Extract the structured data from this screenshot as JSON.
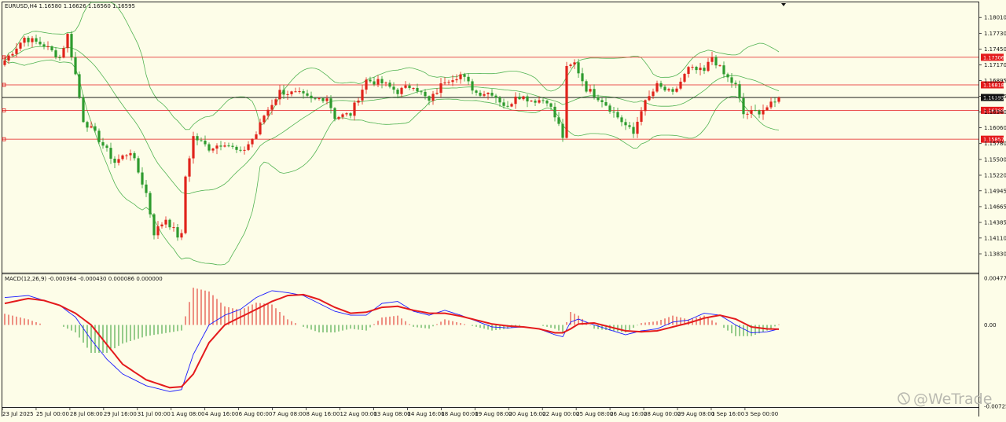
{
  "window": {
    "symbol_info": "EURUSD,H4  1.16580 1.16626 1.16560 1.16595",
    "macd_info": "MACD(12,26,9) -0.000364 -0.000430 0.000086 0.000000",
    "watermark": "@WeTrade"
  },
  "colors": {
    "background": "#fdfde8",
    "bull": "#e0231b",
    "bear": "#2e9b2e",
    "band": "#52b352",
    "hline": "#e41a1c",
    "price_line": "#000000",
    "macd_line": "#1a1aff",
    "signal_line": "#e41a1c"
  },
  "chart_data": [
    {
      "type": "candlestick",
      "title": "EURUSD,H4",
      "y_ticks": [
        "1.18010",
        "1.17730",
        "1.17450",
        "1.17170",
        "1.16895",
        "1.16615",
        "1.16340",
        "1.16060",
        "1.15780",
        "1.15500",
        "1.15220",
        "1.14945",
        "1.14665",
        "1.14385",
        "1.14110",
        "1.13830"
      ],
      "ylim": [
        1.1383,
        1.1818
      ],
      "x_ticks": [
        "23 Jul 2025",
        "25 Jul 00:00",
        "28 Jul 08:00",
        "29 Jul 16:00",
        "31 Jul 00:00",
        "1 Aug 08:00",
        "4 Aug 16:00",
        "6 Aug 00:00",
        "7 Aug 08:00",
        "8 Aug 16:00",
        "12 Aug 00:00",
        "13 Aug 08:00",
        "14 Aug 16:00",
        "18 Aug 00:00",
        "19 Aug 08:00",
        "20 Aug 16:00",
        "22 Aug 00:00",
        "25 Aug 08:00",
        "26 Aug 16:00",
        "28 Aug 00:00",
        "29 Aug 08:00",
        "1 Sep 16:00",
        "3 Sep 00:00"
      ],
      "horizontal_levels": [
        {
          "value": 1.17306,
          "label": "1.17306"
        },
        {
          "value": 1.16818,
          "label": "1.16818"
        },
        {
          "value": 1.16368,
          "label": "1.16368"
        },
        {
          "value": 1.15857,
          "label": "1.15857"
        }
      ],
      "current_price": {
        "value": 1.16595,
        "label": "1.16595"
      },
      "indicators": [
        "Bollinger Bands"
      ],
      "candles_close_anchors": [
        [
          0,
          1.1725
        ],
        [
          5,
          1.1765
        ],
        [
          10,
          1.1752
        ],
        [
          14,
          1.173
        ],
        [
          16,
          1.177
        ],
        [
          18,
          1.17
        ],
        [
          20,
          1.162
        ],
        [
          23,
          1.1595
        ],
        [
          28,
          1.1545
        ],
        [
          32,
          1.1565
        ],
        [
          36,
          1.149
        ],
        [
          38,
          1.142
        ],
        [
          41,
          1.1445
        ],
        [
          44,
          1.1415
        ],
        [
          45,
          1.1415
        ],
        [
          46,
          1.152
        ],
        [
          48,
          1.159
        ],
        [
          52,
          1.157
        ],
        [
          56,
          1.158
        ],
        [
          60,
          1.156
        ],
        [
          64,
          1.1595
        ],
        [
          66,
          1.1628
        ],
        [
          70,
          1.167
        ],
        [
          75,
          1.1665
        ],
        [
          78,
          1.1655
        ],
        [
          82,
          1.166
        ],
        [
          84,
          1.1625
        ],
        [
          88,
          1.163
        ],
        [
          92,
          1.169
        ],
        [
          96,
          1.1685
        ],
        [
          100,
          1.167
        ],
        [
          104,
          1.1682
        ],
        [
          108,
          1.1652
        ],
        [
          112,
          1.169
        ],
        [
          116,
          1.17
        ],
        [
          120,
          1.1668
        ],
        [
          124,
          1.1668
        ],
        [
          128,
          1.164
        ],
        [
          130,
          1.1665
        ],
        [
          134,
          1.1655
        ],
        [
          138,
          1.1655
        ],
        [
          141,
          1.161
        ],
        [
          142,
          1.159
        ],
        [
          143,
          1.171
        ],
        [
          145,
          1.172
        ],
        [
          148,
          1.1675
        ],
        [
          152,
          1.1655
        ],
        [
          156,
          1.1625
        ],
        [
          160,
          1.1595
        ],
        [
          162,
          1.164
        ],
        [
          166,
          1.168
        ],
        [
          170,
          1.1665
        ],
        [
          174,
          1.171
        ],
        [
          178,
          1.1705
        ],
        [
          180,
          1.1732
        ],
        [
          183,
          1.17
        ],
        [
          186,
          1.168
        ],
        [
          188,
          1.163
        ],
        [
          192,
          1.1635
        ],
        [
          196,
          1.165
        ],
        [
          197,
          1.16595
        ]
      ]
    },
    {
      "type": "macd",
      "title": "MACD(12,26,9)",
      "y_ticks": [
        "0.004774",
        "0.00",
        "-0.007257"
      ],
      "ylim": [
        -0.007257,
        0.004774
      ],
      "values": {
        "main": -0.000364,
        "signal": -0.00043,
        "histogram": 8.6e-05
      },
      "macd_anchors": [
        [
          0,
          0.0028
        ],
        [
          6,
          0.003
        ],
        [
          10,
          0.0025
        ],
        [
          14,
          0.002
        ],
        [
          18,
          0.0008
        ],
        [
          22,
          -0.0015
        ],
        [
          26,
          -0.0035
        ],
        [
          30,
          -0.005
        ],
        [
          36,
          -0.0062
        ],
        [
          42,
          -0.0068
        ],
        [
          45,
          -0.0066
        ],
        [
          48,
          -0.003
        ],
        [
          52,
          0.0
        ],
        [
          56,
          0.001
        ],
        [
          60,
          0.0016
        ],
        [
          64,
          0.0028
        ],
        [
          68,
          0.0035
        ],
        [
          72,
          0.0033
        ],
        [
          76,
          0.003
        ],
        [
          80,
          0.0022
        ],
        [
          84,
          0.0014
        ],
        [
          88,
          0.001
        ],
        [
          92,
          0.001
        ],
        [
          96,
          0.0022
        ],
        [
          100,
          0.0024
        ],
        [
          104,
          0.0014
        ],
        [
          108,
          0.001
        ],
        [
          112,
          0.0015
        ],
        [
          116,
          0.001
        ],
        [
          120,
          0.0004
        ],
        [
          124,
          -0.0002
        ],
        [
          128,
          -0.0003
        ],
        [
          132,
          -0.0002
        ],
        [
          136,
          -0.0004
        ],
        [
          140,
          -0.001
        ],
        [
          142,
          -0.0012
        ],
        [
          144,
          0.0003
        ],
        [
          146,
          0.0006
        ],
        [
          150,
          0.0
        ],
        [
          154,
          -0.0005
        ],
        [
          158,
          -0.001
        ],
        [
          162,
          -0.0006
        ],
        [
          166,
          -0.0004
        ],
        [
          170,
          0.0003
        ],
        [
          174,
          0.0005
        ],
        [
          178,
          0.0012
        ],
        [
          182,
          0.001
        ],
        [
          186,
          0.0
        ],
        [
          190,
          -0.0008
        ],
        [
          194,
          -0.0007
        ],
        [
          197,
          -0.0004
        ]
      ],
      "signal_anchors": [
        [
          0,
          0.0022
        ],
        [
          6,
          0.0027
        ],
        [
          10,
          0.0025
        ],
        [
          14,
          0.002
        ],
        [
          18,
          0.0012
        ],
        [
          22,
          0.0
        ],
        [
          26,
          -0.002
        ],
        [
          30,
          -0.004
        ],
        [
          36,
          -0.0056
        ],
        [
          42,
          -0.0064
        ],
        [
          45,
          -0.0063
        ],
        [
          48,
          -0.005
        ],
        [
          52,
          -0.0018
        ],
        [
          56,
          0.0
        ],
        [
          60,
          0.0008
        ],
        [
          64,
          0.0016
        ],
        [
          68,
          0.0024
        ],
        [
          72,
          0.003
        ],
        [
          76,
          0.0031
        ],
        [
          80,
          0.0026
        ],
        [
          84,
          0.0018
        ],
        [
          88,
          0.0012
        ],
        [
          92,
          0.0013
        ],
        [
          96,
          0.0018
        ],
        [
          100,
          0.0019
        ],
        [
          104,
          0.0015
        ],
        [
          108,
          0.0012
        ],
        [
          112,
          0.0012
        ],
        [
          116,
          0.0009
        ],
        [
          120,
          0.0005
        ],
        [
          124,
          0.0001
        ],
        [
          128,
          -0.0001
        ],
        [
          132,
          -0.0002
        ],
        [
          136,
          -0.0004
        ],
        [
          140,
          -0.0008
        ],
        [
          142,
          -0.0008
        ],
        [
          144,
          -0.0004
        ],
        [
          146,
          0.0001
        ],
        [
          150,
          0.0002
        ],
        [
          154,
          -0.0002
        ],
        [
          158,
          -0.0006
        ],
        [
          162,
          -0.0007
        ],
        [
          166,
          -0.0006
        ],
        [
          170,
          -0.0002
        ],
        [
          174,
          0.0002
        ],
        [
          178,
          0.0007
        ],
        [
          182,
          0.001
        ],
        [
          186,
          0.0006
        ],
        [
          190,
          -0.0002
        ],
        [
          194,
          -0.0004
        ],
        [
          197,
          -0.00043
        ]
      ]
    }
  ]
}
